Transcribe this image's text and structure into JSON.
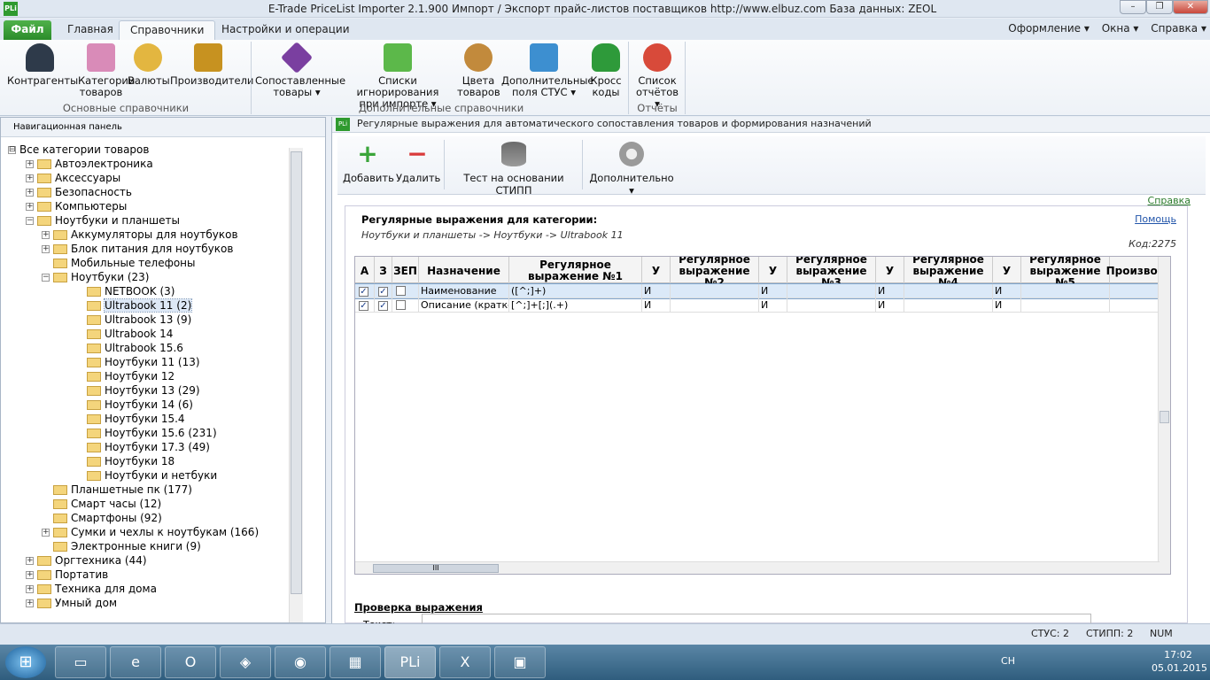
{
  "window": {
    "title": "E-Trade PriceList Importer 2.1.900    Импорт / Экспорт прайс-листов поставщиков    http://www.elbuz.com    База данных: ZEOL",
    "logo_text": "PLi",
    "controls": [
      "–",
      "❐",
      "✕"
    ]
  },
  "ribbon_tabs": {
    "file": "Файл",
    "main": "Главная",
    "references": "Справочники",
    "settings": "Настройки и операции"
  },
  "right_menu": {
    "design": "Оформление ▾",
    "windows": "Окна ▾",
    "help": "Справка ▾"
  },
  "ribbon": {
    "buttons": [
      {
        "label_line1": "Контрагенты",
        "label_line2": "",
        "icon": "person-icon",
        "color": "#2e3a4a"
      },
      {
        "label_line1": "Категории",
        "label_line2": "товаров",
        "icon": "folders-icon",
        "color": "#d98bb8"
      },
      {
        "label_line1": "Валюты",
        "label_line2": "",
        "icon": "coins-icon",
        "color": "#e3b640"
      },
      {
        "label_line1": "Производители",
        "label_line2": "",
        "icon": "factory-robot-icon",
        "color": "#c79220"
      },
      {
        "label_line1": "Сопоставленные",
        "label_line2": "товары ▾",
        "icon": "cube-icon",
        "color": "#7a3fa0"
      },
      {
        "label_line1": "Списки игнорирования",
        "label_line2": "при импорте ▾",
        "icon": "recycle-bin-icon",
        "color": "#5cb84a"
      },
      {
        "label_line1": "Цвета",
        "label_line2": "товаров",
        "icon": "palette-icon",
        "color": "#c28a3c"
      },
      {
        "label_line1": "Дополнительные",
        "label_line2": "поля СТУС ▾",
        "icon": "fields-icon",
        "color": "#3d8fd0"
      },
      {
        "label_line1": "Кросс",
        "label_line2": "коды",
        "icon": "car-icon",
        "color": "#2e9a3a"
      },
      {
        "label_line1": "Список",
        "label_line2": "отчётов ▾",
        "icon": "report-magnifier-icon",
        "color": "#d84a3a"
      }
    ],
    "groups": {
      "main": "Основные справочники",
      "additional": "Дополнительные справочники",
      "reports": "Отчёты"
    }
  },
  "nav": {
    "header": "Навигационная панель",
    "items": [
      {
        "text": "Все категории товаров",
        "level": 0,
        "expander": "⊟",
        "folder": false
      },
      {
        "text": "Автоэлектроника",
        "level": 1,
        "expander": "+",
        "folder": true
      },
      {
        "text": "Аксессуары",
        "level": 1,
        "expander": "+",
        "folder": true
      },
      {
        "text": "Безопасность",
        "level": 1,
        "expander": "+",
        "folder": true
      },
      {
        "text": "Компьютеры",
        "level": 1,
        "expander": "+",
        "folder": true
      },
      {
        "text": "Ноутбуки и планшеты",
        "level": 1,
        "expander": "−",
        "folder": true
      },
      {
        "text": "Аккумуляторы для ноутбуков",
        "level": 2,
        "expander": "+",
        "folder": true
      },
      {
        "text": "Блок питания для ноутбуков",
        "level": 2,
        "expander": "+",
        "folder": true
      },
      {
        "text": "Мобильные телефоны",
        "level": 2,
        "expander": "",
        "folder": true
      },
      {
        "text": "Ноутбуки (23)",
        "level": 2,
        "expander": "−",
        "folder": true
      },
      {
        "text": "NETBOOK (3)",
        "level": 3,
        "expander": "",
        "folder": true
      },
      {
        "text": "Ultrabook 11 (2)",
        "level": 3,
        "expander": "",
        "folder": true,
        "selected": true
      },
      {
        "text": "Ultrabook 13 (9)",
        "level": 3,
        "expander": "",
        "folder": true
      },
      {
        "text": "Ultrabook 14",
        "level": 3,
        "expander": "",
        "folder": true
      },
      {
        "text": "Ultrabook 15.6",
        "level": 3,
        "expander": "",
        "folder": true
      },
      {
        "text": "Ноутбуки 11 (13)",
        "level": 3,
        "expander": "",
        "folder": true
      },
      {
        "text": "Ноутбуки 12",
        "level": 3,
        "expander": "",
        "folder": true
      },
      {
        "text": "Ноутбуки 13 (29)",
        "level": 3,
        "expander": "",
        "folder": true
      },
      {
        "text": "Ноутбуки 14 (6)",
        "level": 3,
        "expander": "",
        "folder": true
      },
      {
        "text": "Ноутбуки 15.4",
        "level": 3,
        "expander": "",
        "folder": true
      },
      {
        "text": "Ноутбуки 15.6 (231)",
        "level": 3,
        "expander": "",
        "folder": true
      },
      {
        "text": "Ноутбуки 17.3 (49)",
        "level": 3,
        "expander": "",
        "folder": true
      },
      {
        "text": "Ноутбуки 18",
        "level": 3,
        "expander": "",
        "folder": true
      },
      {
        "text": "Ноутбуки и нетбуки",
        "level": 3,
        "expander": "",
        "folder": true
      },
      {
        "text": "Планшетные пк (177)",
        "level": 2,
        "expander": "",
        "folder": true
      },
      {
        "text": "Смарт часы (12)",
        "level": 2,
        "expander": "",
        "folder": true
      },
      {
        "text": "Смартфоны (92)",
        "level": 2,
        "expander": "",
        "folder": true
      },
      {
        "text": "Сумки и чехлы к ноутбукам (166)",
        "level": 2,
        "expander": "+",
        "folder": true
      },
      {
        "text": "Электронные книги (9)",
        "level": 2,
        "expander": "",
        "folder": true
      },
      {
        "text": "Оргтехника (44)",
        "level": 1,
        "expander": "+",
        "folder": true
      },
      {
        "text": "Портатив",
        "level": 1,
        "expander": "+",
        "folder": true
      },
      {
        "text": "Техника для дома",
        "level": 1,
        "expander": "+",
        "folder": true
      },
      {
        "text": "Умный дом",
        "level": 1,
        "expander": "+",
        "folder": true
      }
    ]
  },
  "main": {
    "header": "Регулярные выражения для автоматического сопоставления товаров и формирования назначений",
    "header_icon": "PLi",
    "toolbar": {
      "add": "Добавить",
      "delete": "Удалить",
      "test": "Тест на основании СТИПП",
      "more": "Дополнительно ▾"
    },
    "help_link": "Справка",
    "panel": {
      "title": "Регулярные выражения для категории:",
      "path": "Ноутбуки и планшеты -> Ноутбуки -> Ultrabook 11",
      "help": "Помощь",
      "code": "Код:2275"
    },
    "grid": {
      "columns": [
        "А",
        "З",
        "ЗЕП",
        "Назначение",
        "Регулярное выражение №1",
        "У",
        "Регулярное выражение №2",
        "У",
        "Регулярное выражение №3",
        "У",
        "Регулярное выражение №4",
        "У",
        "Регулярное выражение №5",
        "Производ"
      ],
      "rows": [
        {
          "a": "✓",
          "z": "✓",
          "zep": "",
          "purpose": "Наименование",
          "re1": "([^;]+)",
          "u1": "И",
          "re2": "",
          "u2": "И",
          "re3": "",
          "u3": "И",
          "re4": "",
          "u4": "И",
          "re5": "",
          "prod": ""
        },
        {
          "a": "✓",
          "z": "✓",
          "zep": "",
          "purpose": "Описание (краткое",
          "re1": "[^;]+[;](.+)",
          "u1": "И",
          "re2": "",
          "u2": "И",
          "re3": "",
          "u3": "И",
          "re4": "",
          "u4": "И",
          "re5": "",
          "prod": ""
        }
      ],
      "hscroll_grip": "III"
    },
    "check_section": "Проверка выражения",
    "text_label": "Текст:"
  },
  "status": {
    "stus": "СТУС: 2",
    "stipp": "СТИПП: 2",
    "num": "NUM"
  },
  "taskbar": {
    "start": "⊞",
    "apps": [
      {
        "icon": "folder-icon",
        "glyph": "▭"
      },
      {
        "icon": "ie-icon",
        "glyph": "e"
      },
      {
        "icon": "opera-icon",
        "glyph": "O"
      },
      {
        "icon": "eye-app-icon",
        "glyph": "◈"
      },
      {
        "icon": "chrome-icon",
        "glyph": "◉"
      },
      {
        "icon": "calculator-icon",
        "glyph": "▦"
      },
      {
        "icon": "pli-app-icon",
        "glyph": "PLi"
      },
      {
        "icon": "excel-icon",
        "glyph": "X"
      },
      {
        "icon": "save-disk-icon",
        "glyph": "▣"
      }
    ],
    "lang": "СН",
    "time": "17:02",
    "date": "05.01.2015"
  }
}
